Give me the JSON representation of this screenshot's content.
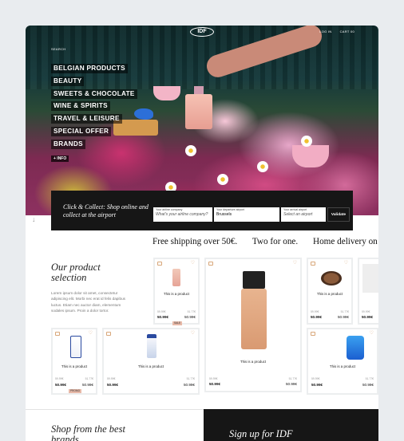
{
  "header": {
    "logo": "IDF",
    "nav": {
      "login": "LOG IN",
      "cart": "CART",
      "cart_count": "00"
    },
    "search": "SEARCH"
  },
  "menu": {
    "items": [
      "BELGIAN PRODUCTS",
      "BEAUTY",
      "SWEETS & CHOCOLATE",
      "WINE & SPIRITS",
      "TRAVEL & LEISURE",
      "SPECIAL OFFER",
      "BRANDS"
    ],
    "more": "+ INFO"
  },
  "click_collect": {
    "text": "Click & Collect: Shop online and collect at the airport",
    "company_label": "Your airline company",
    "company_placeholder": "What's your airline company?",
    "departure_label": "Your departure airport",
    "departure_value": "Brussels",
    "arrival_label": "Your arrival airport",
    "arrival_placeholder": "Select an airport",
    "validate": "Validate"
  },
  "banner": [
    "Free shipping over 50€.",
    "Two for one.",
    "Home delivery on us"
  ],
  "selection": {
    "title": "Our product selection",
    "text": "Lorem ipsum dolor sit amet, consectetur adipiscing elit. Morbi nec erat id felis dapibus luctus. Etiam nec auctor diam, elementum sodales ipsum. Proin a dolor tortor."
  },
  "products": [
    {
      "name": "This is a product",
      "old": "59.99€",
      "price": "50.99€",
      "old2": "51.77€",
      "price2": "50.99€",
      "badge": "SALE"
    },
    {
      "name": "This is a product",
      "old": "59.99€",
      "price": "50.99€",
      "old2": "51.77€",
      "price2": "50.99€"
    },
    {
      "name": "This is a product",
      "old": "59.99€",
      "price": "50.99€",
      "old2": "51.77€",
      "price2": "50.99€"
    },
    {
      "name": "This is a product",
      "old": "59.99€",
      "price": "50.99€",
      "old2": "51.77€",
      "price2": "50.99€",
      "badge": "PROMO"
    },
    {
      "name": "This is a product",
      "old": "59.99€",
      "price": "50.99€",
      "old2": "51.77€",
      "price2": "50.99€"
    },
    {
      "name": "This is a product",
      "old": "59.99€",
      "price": "50.99€",
      "old2": "51.77€",
      "price2": "50.99€"
    },
    {
      "name": "This is a product",
      "old": "59.99€",
      "price": "50.99€"
    }
  ],
  "bottom": {
    "shop_title": "Shop from the best brands",
    "signup": "Sign up for IDF"
  },
  "colors": {
    "accent": "#d8a77a",
    "dark": "#161616",
    "badge": "#e7b9a8"
  }
}
